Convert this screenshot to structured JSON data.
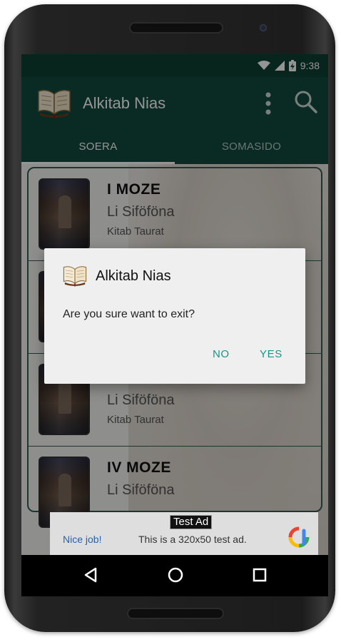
{
  "status_bar": {
    "time": "9:38",
    "icons": [
      "wifi-icon",
      "signal-icon",
      "battery-charging-icon"
    ]
  },
  "app_bar": {
    "title": "Alkitab Nias",
    "logo": "bible-book-icon",
    "actions": [
      "overflow-menu-icon",
      "search-icon"
    ]
  },
  "tabs": [
    {
      "label": "SOERA",
      "selected": true
    },
    {
      "label": "SOMASIDO",
      "selected": false
    }
  ],
  "list": [
    {
      "title": "I MOZE",
      "subtitle": "Li Siföföna",
      "book": "Kitab Taurat"
    },
    {
      "title": "",
      "subtitle": "",
      "book": ""
    },
    {
      "title": "",
      "subtitle": "Li Siföföna",
      "book": "Kitab Taurat"
    },
    {
      "title": "IV MOZE",
      "subtitle": "Li Siföföna",
      "book": ""
    }
  ],
  "ad": {
    "label": "Test Ad",
    "nice": "Nice job!",
    "text": "This is a 320x50 test ad."
  },
  "dialog": {
    "title": "Alkitab Nias",
    "message": "Are you sure want to exit?",
    "no_label": "NO",
    "yes_label": "YES"
  },
  "nav_bar": {
    "buttons": [
      "back-icon",
      "home-icon",
      "recents-icon"
    ]
  },
  "colors": {
    "primary": "#124a3e",
    "primary_dark": "#0d3e33",
    "accent": "#159688"
  }
}
